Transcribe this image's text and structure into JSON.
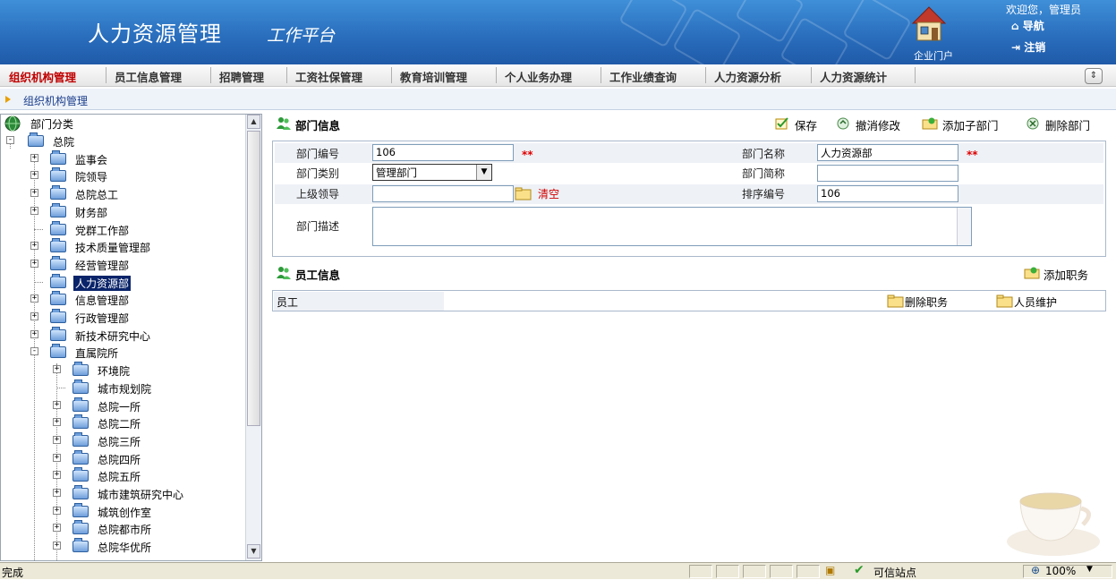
{
  "header": {
    "title": "人力资源管理",
    "subtitle": "工作平台",
    "portal_label": "企业门户",
    "welcome": "欢迎您，管理员",
    "nav_label": "导航",
    "logout_label": "注销"
  },
  "menu": {
    "items": [
      "组织机构管理",
      "员工信息管理",
      "招聘管理",
      "工资社保管理",
      "教育培训管理",
      "个人业务办理",
      "工作业绩查询",
      "人力资源分析",
      "人力资源统计"
    ],
    "active_index": 0
  },
  "breadcrumb": "组织机构管理",
  "tree": {
    "root_label": "部门分类",
    "nodes": [
      {
        "label": "总院",
        "level": 1,
        "expander": "minus"
      },
      {
        "label": "监事会",
        "level": 2,
        "expander": "plus"
      },
      {
        "label": "院领导",
        "level": 2,
        "expander": "plus"
      },
      {
        "label": "总院总工",
        "level": 2,
        "expander": "plus"
      },
      {
        "label": "财务部",
        "level": 2,
        "expander": "plus"
      },
      {
        "label": "党群工作部",
        "level": 2,
        "expander": "none"
      },
      {
        "label": "技术质量管理部",
        "level": 2,
        "expander": "plus"
      },
      {
        "label": "经营管理部",
        "level": 2,
        "expander": "plus"
      },
      {
        "label": "人力资源部",
        "level": 2,
        "expander": "none",
        "selected": true
      },
      {
        "label": "信息管理部",
        "level": 2,
        "expander": "plus"
      },
      {
        "label": "行政管理部",
        "level": 2,
        "expander": "plus"
      },
      {
        "label": "新技术研究中心",
        "level": 2,
        "expander": "plus"
      },
      {
        "label": "直属院所",
        "level": 2,
        "expander": "minus"
      },
      {
        "label": "环境院",
        "level": 3,
        "expander": "plus"
      },
      {
        "label": "城市规划院",
        "level": 3,
        "expander": "none"
      },
      {
        "label": "总院一所",
        "level": 3,
        "expander": "plus"
      },
      {
        "label": "总院二所",
        "level": 3,
        "expander": "plus"
      },
      {
        "label": "总院三所",
        "level": 3,
        "expander": "plus"
      },
      {
        "label": "总院四所",
        "level": 3,
        "expander": "plus"
      },
      {
        "label": "总院五所",
        "level": 3,
        "expander": "plus"
      },
      {
        "label": "城市建筑研究中心",
        "level": 3,
        "expander": "plus"
      },
      {
        "label": "城筑创作室",
        "level": 3,
        "expander": "plus"
      },
      {
        "label": "总院都市所",
        "level": 3,
        "expander": "plus"
      },
      {
        "label": "总院华优所",
        "level": 3,
        "expander": "plus"
      }
    ]
  },
  "dept_info": {
    "title": "部门信息",
    "toolbar": {
      "save": "保存",
      "undo": "撤消修改",
      "add_child": "添加子部门",
      "delete": "删除部门"
    },
    "fields": {
      "code_label": "部门编号",
      "code_value": "106",
      "name_label": "部门名称",
      "name_value": "人力资源部",
      "type_label": "部门类别",
      "type_value": "管理部门",
      "short_label": "部门简称",
      "short_value": "",
      "leader_label": "上级领导",
      "leader_value": "",
      "clear_label": "清空",
      "order_label": "排序编号",
      "order_value": "106",
      "desc_label": "部门描述",
      "desc_value": "",
      "required_mark": "**"
    }
  },
  "emp_info": {
    "title": "员工信息",
    "add_position": "添加职务",
    "col_employee": "员工",
    "delete_position": "删除职务",
    "maintain": "人员维护"
  },
  "statusbar": {
    "status": "完成",
    "trusted": "可信站点",
    "zoom": "100%"
  },
  "colors": {
    "banner": "#2a6fbe",
    "menu_active": "#c00000",
    "required": "#e00000",
    "selection": "#0a246a"
  }
}
